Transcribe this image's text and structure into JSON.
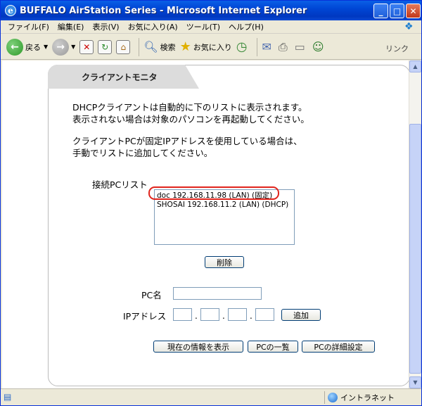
{
  "window": {
    "title": "BUFFALO AirStation Series - Microsoft Internet Explorer",
    "controls": {
      "minimize": "_",
      "maximize": "□",
      "close": "✕"
    }
  },
  "menu": {
    "items": [
      "ファイル(F)",
      "編集(E)",
      "表示(V)",
      "お気に入り(A)",
      "ツール(T)",
      "ヘルプ(H)"
    ]
  },
  "toolbar": {
    "back_label": "戻る",
    "search_label": "検索",
    "favorites_label": "お気に入り",
    "links_label": "リンク"
  },
  "page": {
    "tab_title": "クライアントモニタ",
    "desc1_line1": "DHCPクライアントは自動的に下のリストに表示されます。",
    "desc1_line2": "表示されない場合は対象のパソコンを再起動してください。",
    "desc2_line1": "クライアントPCが固定IPアドレスを使用している場合は、",
    "desc2_line2": "手動でリストに追加してください。",
    "list_label": "接続PCリスト",
    "list_items": [
      "doc 192.168.11.98 (LAN) (固定)",
      "SHOSAI 192.168.11.2 (LAN) (DHCP)"
    ],
    "delete_button": "削除",
    "pc_name_label": "PC名",
    "pc_name_value": "",
    "ip_label": "IPアドレス",
    "ip_sep": ".",
    "add_button": "追加",
    "show_info_button": "現在の情報を表示",
    "pc_list_button": "PCの一覧",
    "pc_detail_button": "PCの詳細設定"
  },
  "status": {
    "zone": "イントラネット"
  },
  "colors": {
    "titlebar": "#0046d5",
    "highlight_ring": "#e0241c",
    "tab_bg": "#dcdcdc"
  }
}
